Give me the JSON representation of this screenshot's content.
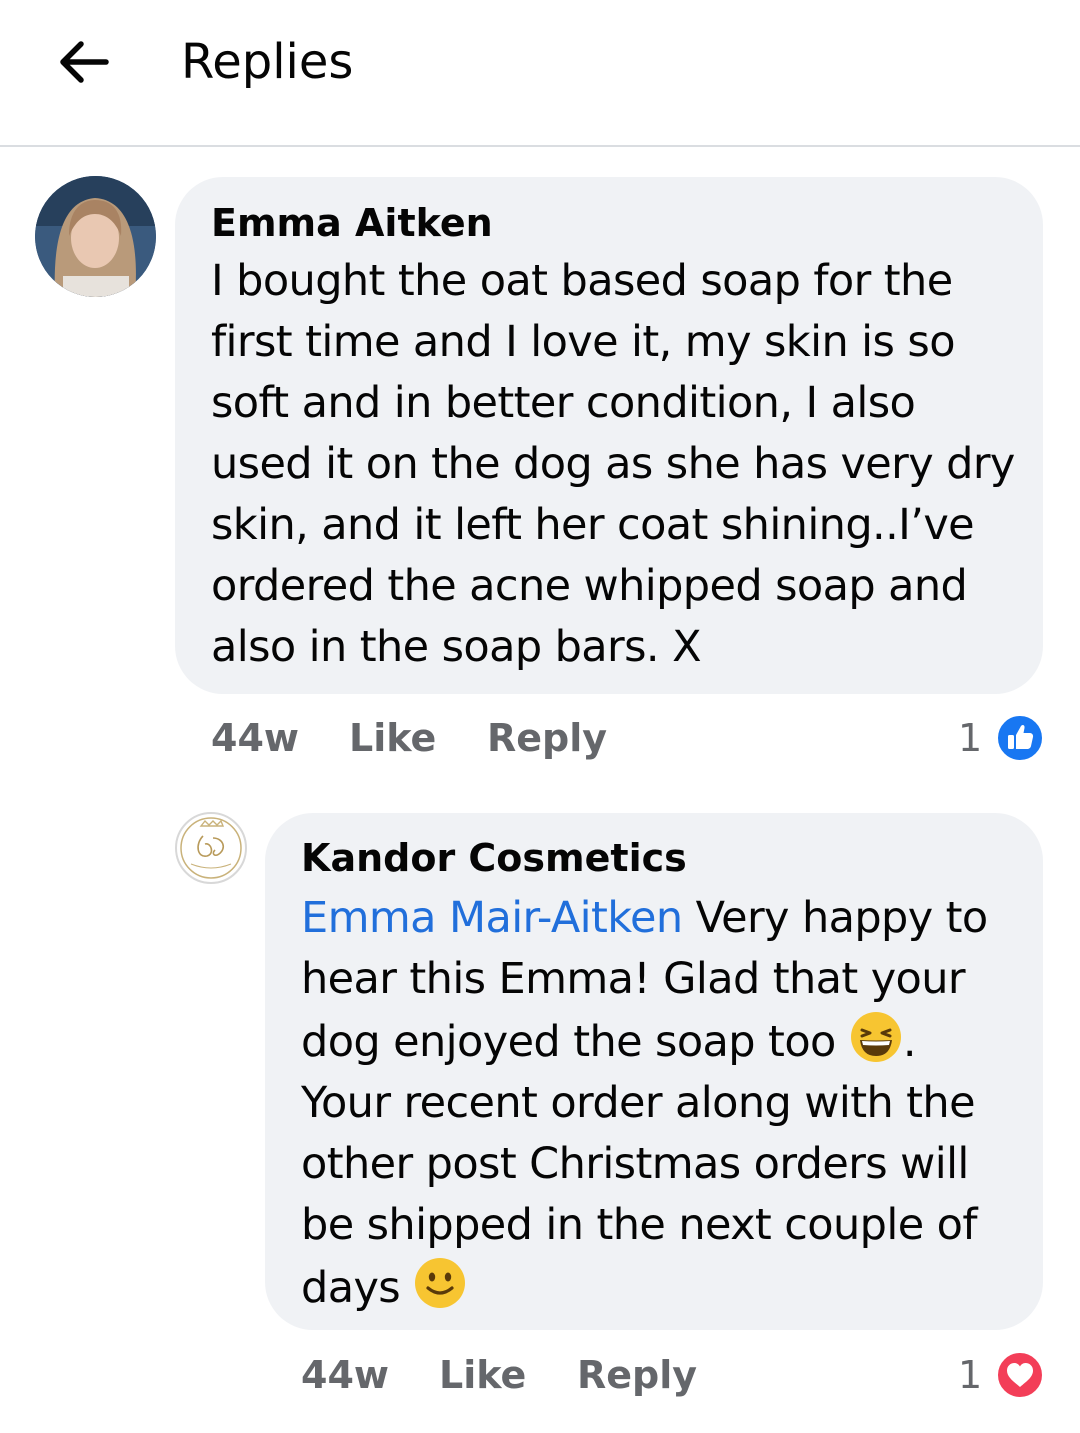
{
  "header": {
    "title": "Replies",
    "back_icon": "arrow-left-icon"
  },
  "comments": [
    {
      "author": "Emma Aitken",
      "avatar": "user-photo-avatar",
      "lines": [
        "I bought the oat based soap for the",
        "first time and I love it, my skin is so",
        "soft and in better condition, I also",
        "used it on the dog as she has very dry",
        "skin, and it left her coat shining..I’ve",
        "ordered the acne whipped soap and",
        "also in the soap bars. X"
      ],
      "time": "44w",
      "like_label": "Like",
      "reply_label": "Reply",
      "reaction_count": "1",
      "reaction_icon": "like-thumbs-up-icon",
      "reaction_color": "#1877f2"
    },
    {
      "author": "Kandor Cosmetics",
      "avatar": "kandor-logo-avatar",
      "mention": "Emma Mair-Aitken",
      "line1_rest": " Very happy to",
      "line2": "hear this Emma! Glad that your",
      "line3_before_emoji": "dog enjoyed the soap too ",
      "line3_after_emoji": ".",
      "line4": "Your recent order along with the",
      "line5": "other post Christmas orders will",
      "line6": "be shipped in the next couple of",
      "line7_before_emoji": "days ",
      "emoji_grin": "grinning-squinting-face-emoji",
      "emoji_smile": "slightly-smiling-face-emoji",
      "time": "44w",
      "like_label": "Like",
      "reply_label": "Reply",
      "reaction_count": "1",
      "reaction_icon": "love-heart-icon",
      "reaction_color": "#f33e58"
    }
  ],
  "colors": {
    "mention": "#216fdb",
    "bubble": "#f0f2f5",
    "meta": "#65676b"
  }
}
